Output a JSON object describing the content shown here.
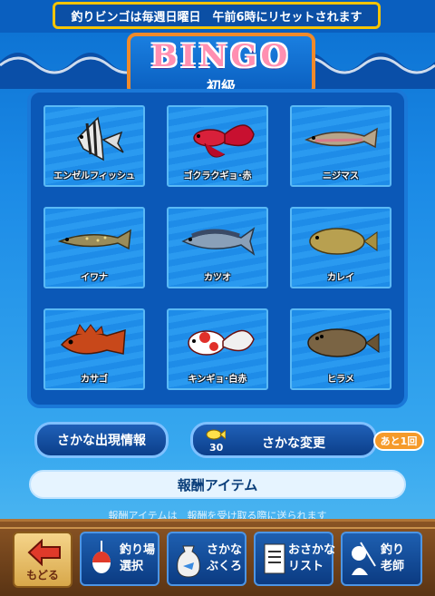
{
  "header": {
    "reset_notice": "釣りビンゴは毎週日曜日　午前6時にリセットされます"
  },
  "bingo": {
    "title": "BINGO",
    "level": "初級"
  },
  "cells": [
    {
      "label": "エンゼルフィッシュ",
      "icon": "angelfish-icon"
    },
    {
      "label": "ゴクラクギョ･赤",
      "icon": "betta-icon"
    },
    {
      "label": "ニジマス",
      "icon": "trout-icon"
    },
    {
      "label": "イワナ",
      "icon": "char-icon"
    },
    {
      "label": "カツオ",
      "icon": "bonito-icon"
    },
    {
      "label": "カレイ",
      "icon": "flounder-icon"
    },
    {
      "label": "カサゴ",
      "icon": "scorpionfish-icon"
    },
    {
      "label": "キンギョ･白赤",
      "icon": "goldfish-icon"
    },
    {
      "label": "ヒラメ",
      "icon": "halibut-icon"
    }
  ],
  "actions": {
    "appearance_info": "さかな出現情報",
    "change_fish": "さかな変更",
    "change_cost": "30",
    "remaining": "あと1回"
  },
  "reward": {
    "header": "報酬アイテム",
    "sub": "報酬アイテムは　報酬を受け取る際に送られます"
  },
  "nav": {
    "back": "もどる",
    "fishing_spot": "釣り場\n選択",
    "fish_bag": "さかな\nぶくろ",
    "fish_list": "おさかな\nリスト",
    "fishing_master": "釣り\n老師"
  },
  "colors": {
    "accent": "#f08a2a",
    "notice_border": "#f5c400",
    "board": "#0b58b7"
  }
}
